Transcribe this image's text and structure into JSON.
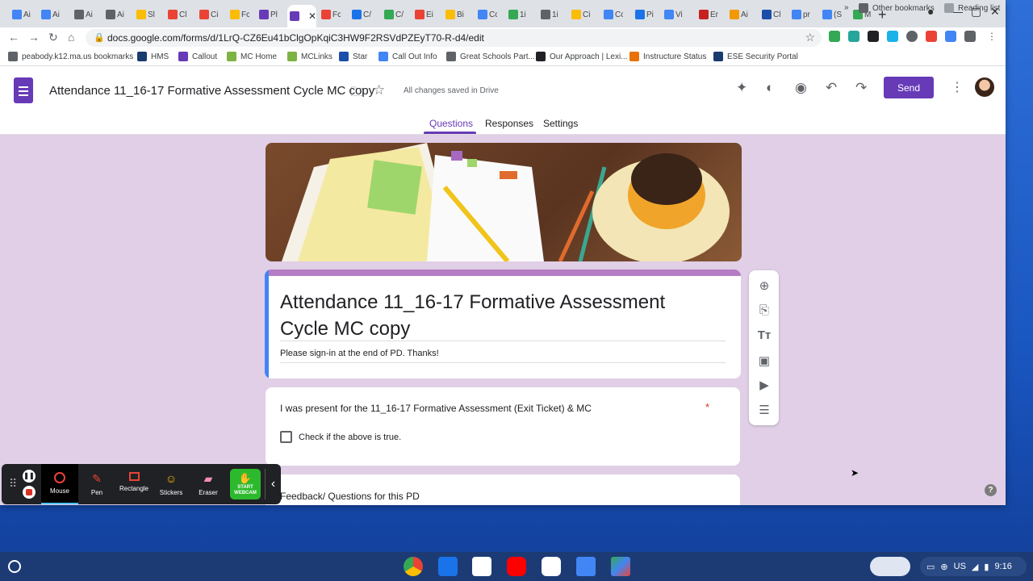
{
  "browser": {
    "tabs": [
      {
        "label": "Ai",
        "color": "#4285f4"
      },
      {
        "label": "Ai",
        "color": "#4285f4"
      },
      {
        "label": "Ai",
        "color": "#5f6368"
      },
      {
        "label": "Ai",
        "color": "#5f6368"
      },
      {
        "label": "Sl",
        "color": "#fbbc04"
      },
      {
        "label": "Cl",
        "color": "#ea4335"
      },
      {
        "label": "Ci",
        "color": "#ea4335"
      },
      {
        "label": "Fc",
        "color": "#fbbc04"
      },
      {
        "label": "Pl",
        "color": "#673ab7"
      },
      {
        "label": "",
        "color": "#673ab7"
      },
      {
        "label": "Fc",
        "color": "#ea4335"
      },
      {
        "label": "C/",
        "color": "#1a73e8"
      },
      {
        "label": "C/",
        "color": "#34a853"
      },
      {
        "label": "Ei",
        "color": "#ea4335"
      },
      {
        "label": "Bi",
        "color": "#fbbc04"
      },
      {
        "label": "Cc",
        "color": "#4285f4"
      },
      {
        "label": "1i",
        "color": "#34a853"
      },
      {
        "label": "1i",
        "color": "#5f6368"
      },
      {
        "label": "Ci",
        "color": "#fbbc04"
      },
      {
        "label": "Cc",
        "color": "#4285f4"
      },
      {
        "label": "Pi",
        "color": "#1a73e8"
      },
      {
        "label": "Vi",
        "color": "#4285f4"
      },
      {
        "label": "Er",
        "color": "#c5221f"
      },
      {
        "label": "Ai",
        "color": "#f29900"
      },
      {
        "label": "Cl",
        "color": "#1a4ea8"
      },
      {
        "label": "pr",
        "color": "#4285f4"
      },
      {
        "label": "(S",
        "color": "#4285f4"
      },
      {
        "label": "M",
        "color": "#34a853"
      }
    ],
    "url": "docs.google.com/forms/d/1LrQ-CZ6Eu41bClgOpKqiC3HW9F2RSVdPZEyT70-R-d4/edit",
    "bookmarks": [
      {
        "label": "peabody.k12.ma.us bookmarks",
        "color": "#5f6368"
      },
      {
        "label": "HMS",
        "color": "#1a3b6e"
      },
      {
        "label": "Callout",
        "color": "#673ab7"
      },
      {
        "label": "MC Home",
        "color": "#7cb342"
      },
      {
        "label": "MCLinks",
        "color": "#7cb342"
      },
      {
        "label": "Star",
        "color": "#1a4ea8"
      },
      {
        "label": "Call Out Info",
        "color": "#4285f4"
      },
      {
        "label": "Great Schools Part...",
        "color": "#5f6368"
      },
      {
        "label": "Our Approach | Lexi...",
        "color": "#202124"
      },
      {
        "label": "Instructure Status",
        "color": "#e8710a"
      },
      {
        "label": "ESE Security Portal",
        "color": "#1a3b6e"
      }
    ],
    "other_bookmarks": "Other bookmarks",
    "reading_list": "Reading list"
  },
  "forms_header": {
    "doc_title": "Attendance 11_16-17  Formative Assessment Cycle  MC copy",
    "saved_status": "All changes saved in Drive",
    "send_label": "Send",
    "tabs": [
      "Questions",
      "Responses",
      "Settings"
    ],
    "active_tab": "Questions",
    "accent": "#673ab7"
  },
  "form": {
    "title": " Attendance 11_16-17  Formative Assessment Cycle  MC copy",
    "description": "Please sign-in at the end of PD.  Thanks!",
    "questions": [
      {
        "text": "I was present for the  11_16-17  Formative Assessment (Exit Ticket) & MC",
        "required_mark": "*",
        "option": "Check if the above is true."
      },
      {
        "text": "Feedback/ Questions for this PD"
      }
    ]
  },
  "side_tools": [
    "add-question-icon",
    "import-questions-icon",
    "add-title-icon",
    "add-image-icon",
    "add-video-icon",
    "add-section-icon"
  ],
  "recorder": {
    "tools": [
      {
        "label": "Mouse",
        "icon": "mouse-icon",
        "active": true
      },
      {
        "label": "Pen",
        "icon": "pen-icon"
      },
      {
        "label": "Rectangle",
        "icon": "rectangle-icon"
      },
      {
        "label": "Stickers",
        "icon": "sticker-icon"
      },
      {
        "label": "Eraser",
        "icon": "eraser-icon"
      }
    ],
    "webcam_label": "START WEBCAM"
  },
  "shelf": {
    "apps": [
      "Chrome",
      "Files",
      "Gmail",
      "YouTube",
      "Meet",
      "Docs",
      "Play Store"
    ],
    "ime": "US",
    "clock": "9:16"
  }
}
